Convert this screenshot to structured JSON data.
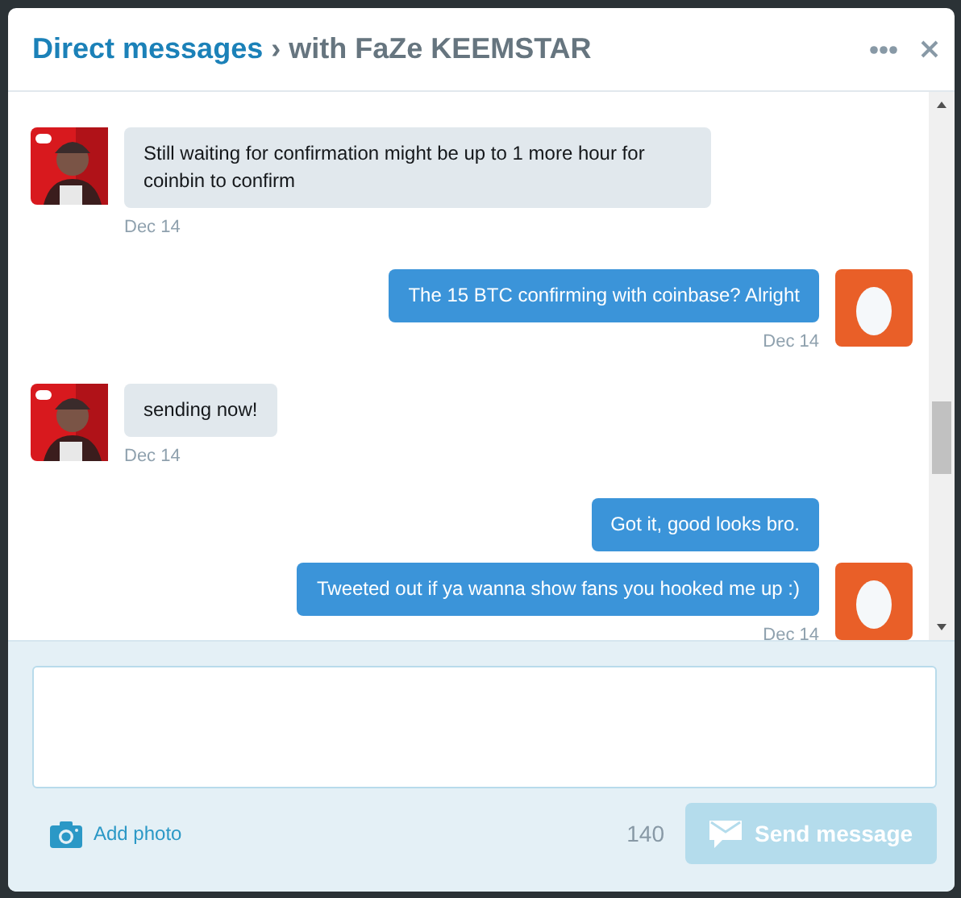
{
  "header": {
    "title_link": "Direct messages",
    "separator": "›",
    "title_rest": "with FaZe KEEMSTAR"
  },
  "groups": [
    {
      "kind": "received",
      "messages": [
        "Still waiting for confirmation might be up to 1 more hour for coinbin to confirm"
      ],
      "time": "Dec 14"
    },
    {
      "kind": "sent",
      "messages": [
        "The 15 BTC confirming with coinbase? Alright"
      ],
      "time": "Dec 14"
    },
    {
      "kind": "received",
      "messages": [
        "sending now!"
      ],
      "time": "Dec 14"
    },
    {
      "kind": "sent",
      "messages": [
        "Got it, good looks bro.",
        "Tweeted out if ya wanna show fans you hooked me up :)"
      ],
      "time": "Dec 14"
    }
  ],
  "composer": {
    "add_photo": "Add photo",
    "count": "140",
    "send_label": "Send message",
    "send_disabled": true
  }
}
